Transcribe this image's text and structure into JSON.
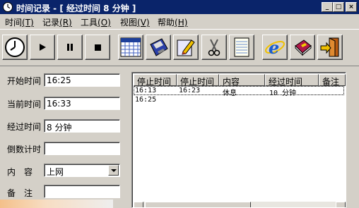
{
  "window": {
    "title": "时间记录 - [ 经过时间 8 分钟 ]",
    "buttons": {
      "minimize": "_",
      "maximize": "□",
      "close": "×"
    }
  },
  "menu": [
    {
      "label": "时间",
      "key": "(T)"
    },
    {
      "label": "记录",
      "key": "(R)"
    },
    {
      "label": "工具",
      "key": "(O)"
    },
    {
      "label": "视图",
      "key": "(V)"
    },
    {
      "label": "帮助",
      "key": "(H)"
    }
  ],
  "toolbar": {
    "buttons": [
      "clock-icon",
      "play-icon",
      "pause-icon",
      "stop-icon",
      "calendar-icon",
      "disk-icon",
      "pencil-icon",
      "scissors-icon",
      "notepad-icon",
      "internet-explorer-icon",
      "book-icon",
      "exit-door-icon"
    ]
  },
  "form": {
    "start_time": {
      "label": "开始时间",
      "value": "16:25"
    },
    "current_time": {
      "label": "当前时间",
      "value": "16:33"
    },
    "elapsed_time": {
      "label": "经过时间",
      "value": "8 分钟"
    },
    "countdown": {
      "label": "倒数计时",
      "value": ""
    },
    "content": {
      "label": "内　容",
      "value": "上网"
    },
    "note": {
      "label": "备　注",
      "value": ""
    }
  },
  "table": {
    "columns": [
      "停止时间",
      "停止时间",
      "内容",
      "经过时间",
      "备注"
    ],
    "rows": [
      [
        "16:13",
        "16:23",
        "休息",
        "10 分钟",
        ""
      ],
      [
        "16:25",
        "",
        "",
        "",
        ""
      ]
    ]
  },
  "colors": {
    "titlebar": "#0a246a",
    "face": "#d4d0c8"
  }
}
